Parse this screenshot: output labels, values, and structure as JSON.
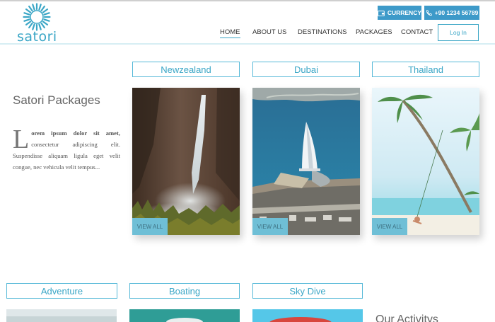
{
  "brand": {
    "name": "satori"
  },
  "top_buttons": {
    "currency": "CURRENCY",
    "phone": "+90 1234 56789"
  },
  "nav": {
    "items": [
      {
        "label": "HOME",
        "active": true
      },
      {
        "label": "ABOUT US",
        "active": false
      },
      {
        "label": "DESTINATIONS",
        "active": false
      },
      {
        "label": "PACKAGES",
        "active": false
      },
      {
        "label": "CONTACT",
        "active": false
      }
    ],
    "login": "Log In"
  },
  "intro": {
    "title": "Satori Packages",
    "dropcap": "L",
    "bold_text": "orem ipsum dolor sit amet,",
    "text": " consectetur adipiscing elit. Suspendisse aliquam ligula eget velit congue, nec vehicula velit tempus..."
  },
  "destinations": [
    {
      "name": "Newzealand",
      "cta": "VIEW ALL"
    },
    {
      "name": "Dubai",
      "cta": "VIEW ALL"
    },
    {
      "name": "Thailand",
      "cta": "VIEW ALL"
    }
  ],
  "activities": {
    "items": [
      {
        "name": "Adventure"
      },
      {
        "name": "Boating"
      },
      {
        "name": "Sky Dive"
      }
    ],
    "title": "Our Activitys"
  },
  "colors": {
    "accent": "#3aa6c6",
    "button": "#3d9ac9",
    "view_all": "#6fbfd6"
  },
  "icons": {
    "currency": "wallet-icon",
    "phone": "phone-icon"
  }
}
